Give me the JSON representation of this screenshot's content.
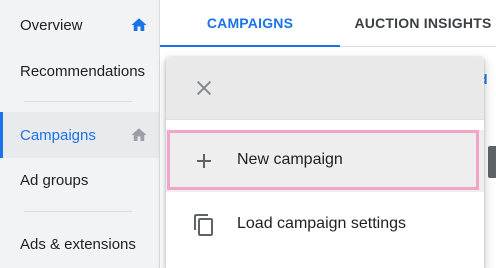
{
  "sidebar": {
    "items": [
      {
        "label": "Overview",
        "icon": "home-icon"
      },
      {
        "label": "Recommendations"
      },
      {
        "label": "Campaigns",
        "icon": "home-icon",
        "active": true
      },
      {
        "label": "Ad groups"
      },
      {
        "label": "Ads & extensions"
      }
    ]
  },
  "tabs": [
    {
      "label": "CAMPAIGNS",
      "active": true
    },
    {
      "label": "AUCTION INSIGHTS"
    }
  ],
  "background": {
    "link_fragment": "d"
  },
  "menu": {
    "close_icon": "close-icon",
    "items": [
      {
        "label": "New campaign",
        "icon": "plus-icon",
        "highlighted": true
      },
      {
        "label": "Load campaign settings",
        "icon": "copy-icon"
      }
    ]
  },
  "colors": {
    "accent": "#1a73e8",
    "sidebar_bg": "#f1f3f4",
    "highlight_ring": "#f3a5c8"
  }
}
